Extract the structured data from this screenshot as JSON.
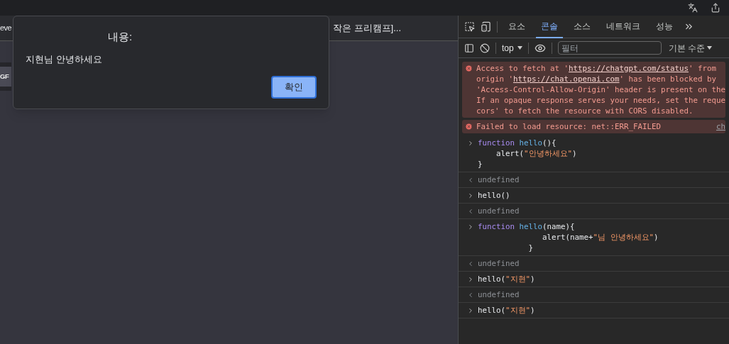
{
  "page": {
    "bookmark_left": "eve",
    "bookmark_right": "작은 프리캠프]...",
    "button": "GF"
  },
  "dialog": {
    "title": "내용:",
    "message": "지현님 안녕하세요",
    "button": "확인"
  },
  "devtools": {
    "tabs": [
      {
        "label": "요소",
        "selected": false
      },
      {
        "label": "콘솔",
        "selected": true
      },
      {
        "label": "소스",
        "selected": false
      },
      {
        "label": "네트워크",
        "selected": false
      },
      {
        "label": "성능",
        "selected": false
      }
    ],
    "context": "top",
    "filter": {
      "placeholder": "필터"
    },
    "level": "기본 수준",
    "entries": [
      {
        "kind": "error",
        "lines": [
          [
            {
              "kind": "text",
              "text": "Access to fetch at '"
            },
            {
              "kind": "link",
              "text": "https://chatgpt.com/status"
            },
            {
              "kind": "text",
              "text": "' from"
            }
          ],
          [
            {
              "kind": "text",
              "text": "origin '"
            },
            {
              "kind": "link",
              "text": "https://chat.openai.com"
            },
            {
              "kind": "text",
              "text": "' has been blocked by"
            }
          ],
          [
            {
              "kind": "text",
              "text": "'Access-Control-Allow-Origin' header is present on the"
            }
          ],
          [
            {
              "kind": "text",
              "text": "If an opaque response serves your needs, set the reque"
            }
          ],
          [
            {
              "kind": "text",
              "text": "cors' to fetch the resource with CORS disabled."
            }
          ]
        ]
      },
      {
        "kind": "error",
        "lines": [
          [
            {
              "kind": "text",
              "text": "Failed to load resource: net::ERR_FAILED"
            }
          ]
        ],
        "source": "ch"
      },
      {
        "kind": "input",
        "lines": [
          [
            {
              "kind": "keyword",
              "text": "function "
            },
            {
              "kind": "fn",
              "text": "hello"
            },
            {
              "kind": "plain",
              "text": "(){"
            }
          ],
          [
            {
              "kind": "plain",
              "text": "    alert("
            },
            {
              "kind": "string",
              "text": "\"안녕하세요\""
            },
            {
              "kind": "plain",
              "text": ")"
            }
          ],
          [
            {
              "kind": "plain",
              "text": "}"
            }
          ]
        ]
      },
      {
        "kind": "output",
        "lines": [
          [
            {
              "kind": "plain",
              "text": "undefined"
            }
          ]
        ]
      },
      {
        "kind": "input",
        "lines": [
          [
            {
              "kind": "plain",
              "text": "hello()"
            }
          ]
        ]
      },
      {
        "kind": "output",
        "lines": [
          [
            {
              "kind": "plain",
              "text": "undefined"
            }
          ]
        ]
      },
      {
        "kind": "input",
        "lines": [
          [
            {
              "kind": "keyword",
              "text": "function "
            },
            {
              "kind": "fn",
              "text": "hello"
            },
            {
              "kind": "plain",
              "text": "(name){"
            }
          ],
          [
            {
              "kind": "plain",
              "text": "              alert(name+"
            },
            {
              "kind": "string",
              "text": "\"님 안녕하세요\""
            },
            {
              "kind": "plain",
              "text": ")"
            }
          ],
          [
            {
              "kind": "plain",
              "text": "           }"
            }
          ]
        ]
      },
      {
        "kind": "output",
        "lines": [
          [
            {
              "kind": "plain",
              "text": "undefined"
            }
          ]
        ]
      },
      {
        "kind": "input",
        "lines": [
          [
            {
              "kind": "plain",
              "text": "hello("
            },
            {
              "kind": "string",
              "text": "\"지현\""
            },
            {
              "kind": "plain",
              "text": ")"
            }
          ]
        ]
      },
      {
        "kind": "output",
        "lines": [
          [
            {
              "kind": "plain",
              "text": "undefined"
            }
          ]
        ]
      },
      {
        "kind": "input",
        "lines": [
          [
            {
              "kind": "plain",
              "text": "hello("
            },
            {
              "kind": "string",
              "text": "\"지현\""
            },
            {
              "kind": "plain",
              "text": ")"
            }
          ]
        ]
      }
    ]
  }
}
